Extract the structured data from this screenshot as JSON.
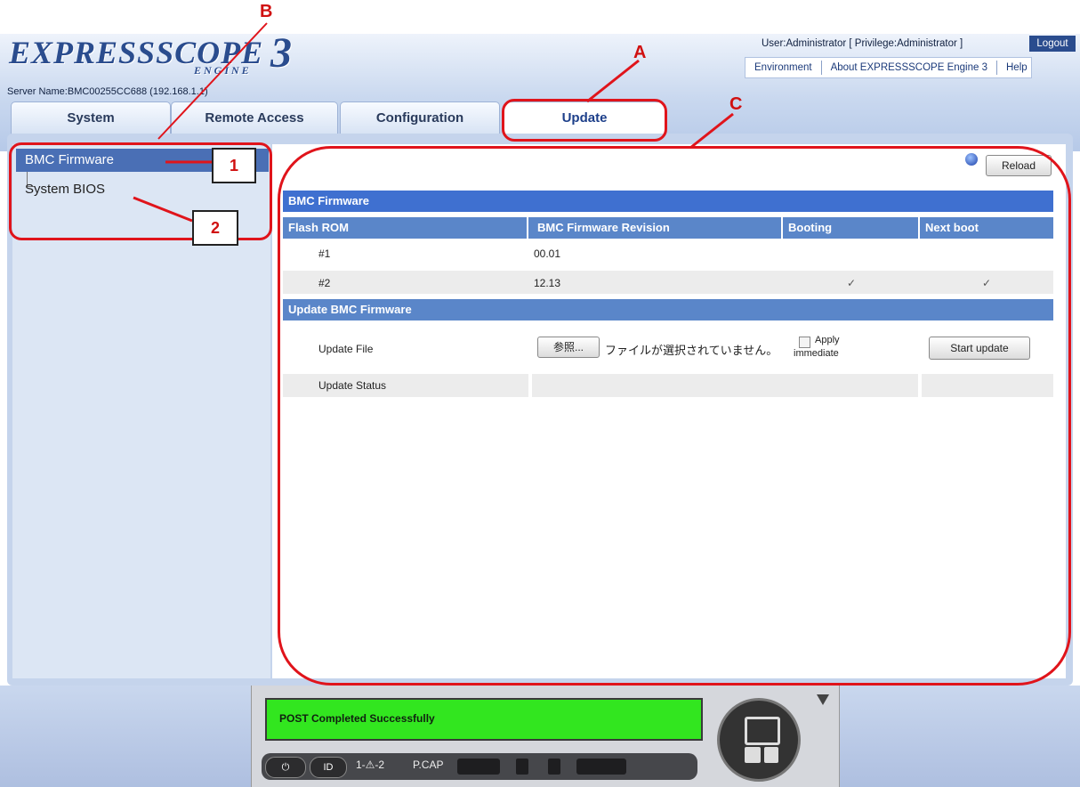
{
  "header": {
    "logo_text": "EXPRESSSCOPE",
    "logo_sub": "ENGINE",
    "logo_num": "3",
    "server_name": "Server Name:BMC00255CC688 (192.168.1.1)",
    "user_line": "User:Administrator [ Privilege:Administrator ]",
    "logout_label": "Logout",
    "links": [
      "Environment",
      "About EXPRESSSCOPE Engine 3",
      "Help"
    ]
  },
  "tabs": [
    "System",
    "Remote Access",
    "Configuration",
    "Update"
  ],
  "sidebar": {
    "items": [
      "BMC Firmware",
      "System BIOS"
    ]
  },
  "reload_label": "Reload",
  "section_title": "BMC Firmware",
  "table": {
    "columns": [
      "Flash ROM",
      "BMC Firmware Revision",
      "Booting",
      "Next boot"
    ],
    "rows": [
      {
        "rom": "#1",
        "revision": "00.01",
        "booting": "",
        "next": ""
      },
      {
        "rom": "#2",
        "revision": "12.13",
        "booting": "✓",
        "next": "✓"
      }
    ]
  },
  "update_section": {
    "title": "Update BMC Firmware",
    "file_label": "Update File",
    "browse_label": "参照...",
    "no_file_text": "ファイルが選択されていません。",
    "apply_label_1": "Apply",
    "apply_label_2": "immediate",
    "start_label": "Start update",
    "status_label": "Update Status",
    "status_value": ""
  },
  "status_panel": {
    "post_message": "POST Completed Successfully",
    "power_label": "⏻",
    "id_label": "ID",
    "alert_label": "1-⚠-2",
    "pcap_label": "P.CAP"
  },
  "annotations": {
    "A": "A",
    "B": "B",
    "C": "C",
    "n1": "1",
    "n2": "2"
  },
  "colors": {
    "accent": "#3f70d0",
    "header_row": "#5a86c9",
    "annotation": "#e0141b",
    "post_ok": "#32e61f"
  }
}
